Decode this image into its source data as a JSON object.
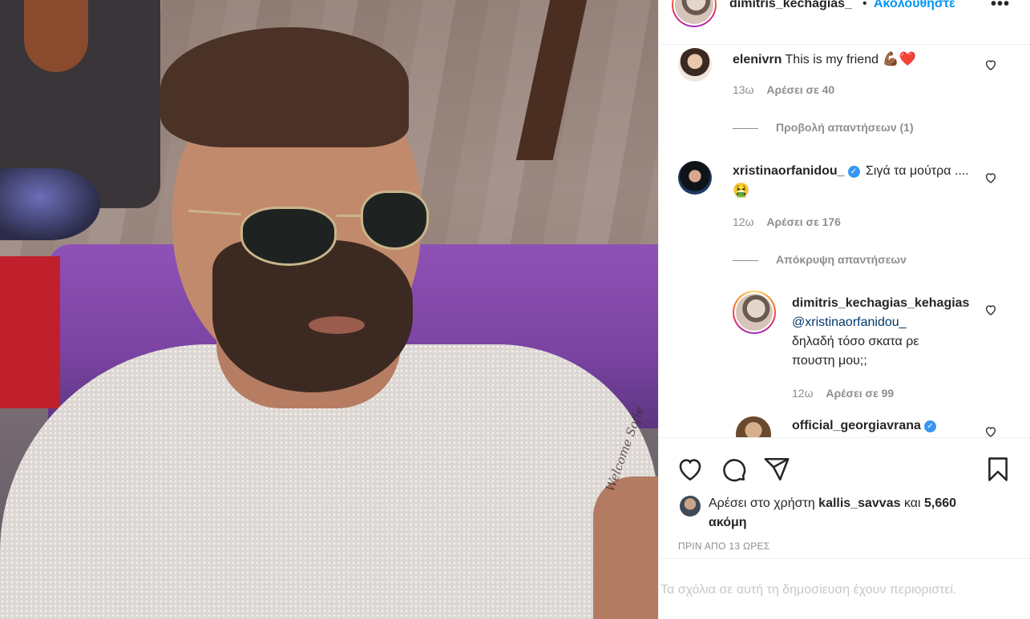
{
  "header": {
    "username": "dimitris_kechagias_",
    "separator": "•",
    "follow_label": "Ακολουθήστε",
    "more_label": "•••",
    "more_icon": "more-options-icon"
  },
  "comments": [
    {
      "username": "elenivrn",
      "text": "This is my friend",
      "emojis": "💪🏾❤️",
      "time": "13ω",
      "likes": "Αρέσει σε 40",
      "replies_toggle": "Προβολή απαντήσεων (1)"
    },
    {
      "username": "xristinaorfanidou_",
      "verified": true,
      "text": "Σιγά τα μούτρα ....",
      "emojis": "🤮",
      "time": "12ω",
      "likes": "Αρέσει σε 176",
      "replies_toggle": "Απόκρυψη απαντήσεων"
    }
  ],
  "reply": {
    "username": "dimitris_kechagias_kehagias",
    "mention": "@xristinaorfanidou_",
    "text_line1": "δηλαδή τόσο σκατα ρε",
    "text_line2": "πουστη μου;;",
    "time": "12ω",
    "likes": "Αρέσει σε 99"
  },
  "next_comment": {
    "username": "official_georgiavrana",
    "verified": true
  },
  "actions": {
    "like_icon": "heart-icon",
    "comment_icon": "comment-icon",
    "share_icon": "share-icon",
    "save_icon": "bookmark-icon"
  },
  "liked_by": {
    "prefix": "Αρέσει στο χρήστη",
    "user": "kallis_savvas",
    "conjunction": "και",
    "others": "5,660 ακόμη"
  },
  "timestamp": "ΠΡΙΝ ΑΠΟ 13 ΩΡΕΣ",
  "footer": {
    "restricted_text": "Τα σχόλια σε αυτή τη δημοσίευση έχουν περιοριστεί."
  },
  "photo": {
    "tattoo_text": "Welcome Sofie"
  }
}
